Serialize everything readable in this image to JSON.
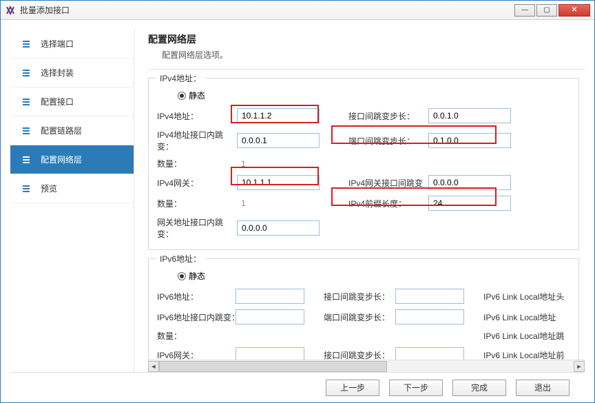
{
  "window": {
    "title": "批量添加接口"
  },
  "sidebar": {
    "items": [
      {
        "label": "选择端口"
      },
      {
        "label": "选择封装"
      },
      {
        "label": "配置接口"
      },
      {
        "label": "配置链路层"
      },
      {
        "label": "配置网络层"
      },
      {
        "label": "预览"
      }
    ],
    "active_index": 4
  },
  "main": {
    "title": "配置网络层",
    "subtitle": "配置网络层选项。"
  },
  "ipv4": {
    "legend": "IPv4地址：",
    "radio_static": "静态",
    "rows": {
      "addr_label": "IPv4地址：",
      "addr_value": "10.1.1.2",
      "if_step_label": "接口间跳变步长：",
      "if_step_value": "0.0.1.0",
      "addr_inner_label": "IPv4地址接口内跳变：",
      "addr_inner_value": "0.0.0.1",
      "port_step_label": "端口间跳变步长：",
      "port_step_value": "0.1.0.0",
      "count_label": "数量：",
      "count_value": "1",
      "gw_label": "IPv4网关：",
      "gw_value": "10.1.1.1",
      "gw_if_step_label": "IPv4网关接口间跳变",
      "gw_if_step_value": "0.0.0.0",
      "count2_label": "数量：",
      "count2_value": "1",
      "prefix_label": "IPv4前缀长度：",
      "prefix_value": "24",
      "gw_inner_label": "网关地址接口内跳变：",
      "gw_inner_value": "0.0.0.0"
    }
  },
  "ipv6": {
    "legend": "IPv6地址：",
    "radio_static": "静态",
    "rows": {
      "addr_label": "IPv6地址：",
      "if_step_label": "接口间跳变步长：",
      "ll_head_label": "IPv6 Link Local地址头",
      "addr_inner_label": "IPv6地址接口内跳变：",
      "port_step_label": "端口间跳变步长：",
      "ll_addr_label": "IPv6 Link Local地址",
      "count_label": "数量：",
      "ll_step_label": "IPv6 Link Local地址跳",
      "gw_label": "IPv6网关：",
      "gw_step_label": "接口间跳变步长：",
      "ll_prefix_label": "IPv6 Link Local地址前"
    }
  },
  "footer": {
    "prev": "上一步",
    "next": "下一步",
    "finish": "完成",
    "exit": "退出"
  }
}
